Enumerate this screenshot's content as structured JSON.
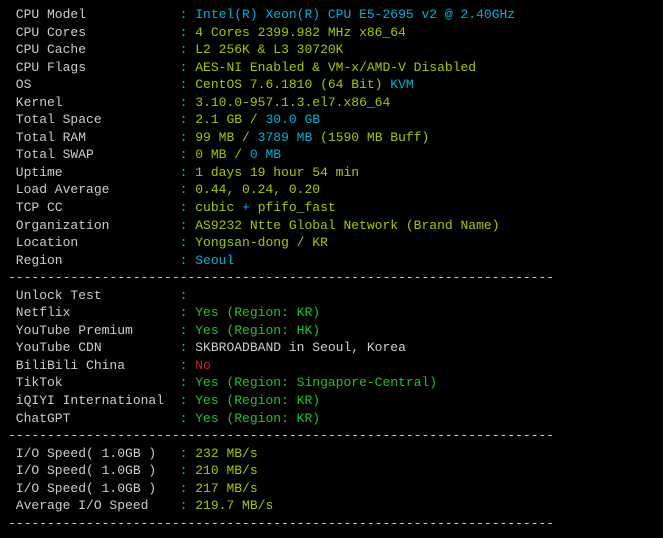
{
  "labels": {
    "cpu_model": "CPU Model",
    "cpu_cores": "CPU Cores",
    "cpu_cache": "CPU Cache",
    "cpu_flags": "CPU Flags",
    "os": "OS",
    "kernel": "Kernel",
    "total_space": "Total Space",
    "total_ram": "Total RAM",
    "total_swap": "Total SWAP",
    "uptime": "Uptime",
    "load_avg": "Load Average",
    "tcp_cc": "TCP CC",
    "organization": "Organization",
    "location": "Location",
    "region": "Region",
    "unlock_test": "Unlock Test",
    "netflix": "Netflix",
    "youtube_premium": "YouTube Premium",
    "youtube_cdn": "YouTube CDN",
    "bilibili": "BiliBili China",
    "tiktok": "TikTok",
    "iqiyi": "iQIYI International",
    "chatgpt": "ChatGPT",
    "io1": "I/O Speed( 1.0GB )",
    "io2": "I/O Speed( 1.0GB )",
    "io3": "I/O Speed( 1.0GB )",
    "io_avg": "Average I/O Speed"
  },
  "values": {
    "cpu_model": "Intel(R) Xeon(R) CPU E5-2695 v2 @ 2.40GHz",
    "cpu_cores_a": "4 Cores 2399.982 MHz x86_64",
    "cpu_cache_a": "L2 256K & L3 30720K",
    "cpu_flags_a": "AES-NI Enabled & VM-x/AMD-V Disabled",
    "os_a": "CentOS 7.6.1810 (64 Bit)",
    "os_b": "KVM",
    "kernel_a": "3.10.0-957.1.3.el7.x86_64",
    "total_space_a": "2.1 GB /",
    "total_space_b": "30.0 GB",
    "total_ram_a": "99 MB /",
    "total_ram_b": "3789 MB",
    "total_ram_c": "(1590 MB Buff)",
    "total_swap_a": "0 MB /",
    "total_swap_b": "0 MB",
    "uptime_a": "1 days 19 hour 54 min",
    "load_avg_a": "0.44, 0.24, 0.20",
    "tcp_cc_a": "cubic",
    "tcp_cc_b": "+",
    "tcp_cc_c": "pfifo_fast",
    "organization_a": "AS9232 Ntte Global Network (Brand Name)",
    "location_a": "Yongsan-dong / KR",
    "region_a": "Seoul",
    "netflix_a": "Yes (Region: KR)",
    "youtube_premium_a": "Yes (Region: HK)",
    "youtube_cdn_a": "SKBROADBAND in Seoul, Korea",
    "bilibili_a": "No",
    "tiktok_a": "Yes (Region: Singapore-Central)",
    "iqiyi_a": "Yes (Region: KR)",
    "chatgpt_a": "Yes (Region: KR)",
    "io1_a": "232 MB/s",
    "io2_a": "210 MB/s",
    "io3_a": "217 MB/s",
    "io_avg_a": "219.7 MB/s"
  },
  "hr": "----------------------------------------------------------------------"
}
